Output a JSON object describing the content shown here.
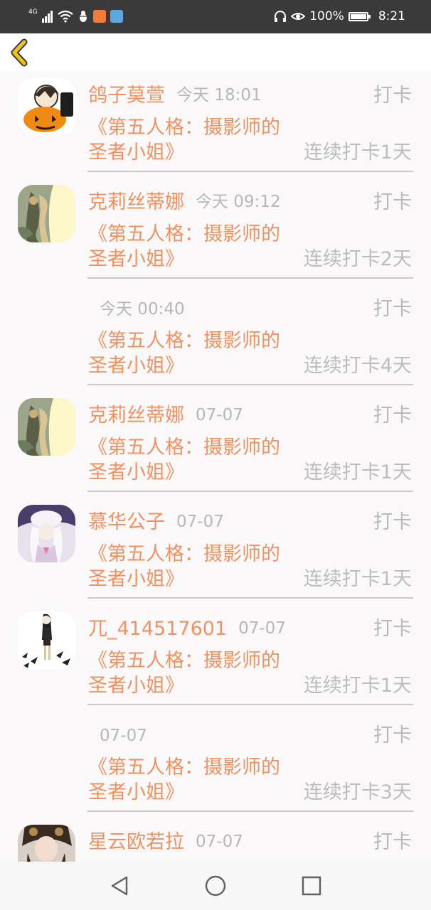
{
  "status_bar": {
    "network_label": "4G",
    "battery_percent_text": "100%",
    "time": "8:21",
    "badge_s_color": "#f07a3a",
    "badge_b_color": "#5aa7e0"
  },
  "header": {
    "back_icon": "chevron-left-icon",
    "accent_color": "#f0c419"
  },
  "colors": {
    "name": "#ee9262",
    "book": "#ee9262",
    "muted": "#b7b7b7",
    "background": "#faf8f9"
  },
  "items": [
    {
      "username": "鸽子莫萱",
      "time": "今天 18:01",
      "checkin": "打卡",
      "book": "《第五人格：摄影师的圣者小姐》",
      "streak": "连续打卡1天"
    },
    {
      "username": "克莉丝蒂娜",
      "time": "今天 09:12",
      "checkin": "打卡",
      "book": "《第五人格：摄影师的圣者小姐》",
      "streak": "连续打卡2天"
    },
    {
      "username": "",
      "time": "今天 00:40",
      "checkin": "打卡",
      "book": "《第五人格：摄影师的圣者小姐》",
      "streak": "连续打卡4天"
    },
    {
      "username": "克莉丝蒂娜",
      "time": "07-07",
      "checkin": "打卡",
      "book": "《第五人格：摄影师的圣者小姐》",
      "streak": "连续打卡1天"
    },
    {
      "username": "慕华公子",
      "time": "07-07",
      "checkin": "打卡",
      "book": "《第五人格：摄影师的圣者小姐》",
      "streak": "连续打卡1天"
    },
    {
      "username": "兀_414517601",
      "time": "07-07",
      "checkin": "打卡",
      "book": "《第五人格：摄影师的圣者小姐》",
      "streak": "连续打卡1天"
    },
    {
      "username": "",
      "time": "07-07",
      "checkin": "打卡",
      "book": "《第五人格：摄影师的圣者小姐》",
      "streak": "连续打卡3天"
    },
    {
      "username": "星云欧若拉",
      "time": "07-07",
      "checkin": "打卡",
      "book": "",
      "streak": ""
    }
  ],
  "nav": {
    "back_icon": "triangle-back-icon",
    "home_icon": "circle-home-icon",
    "recents_icon": "square-recents-icon"
  }
}
